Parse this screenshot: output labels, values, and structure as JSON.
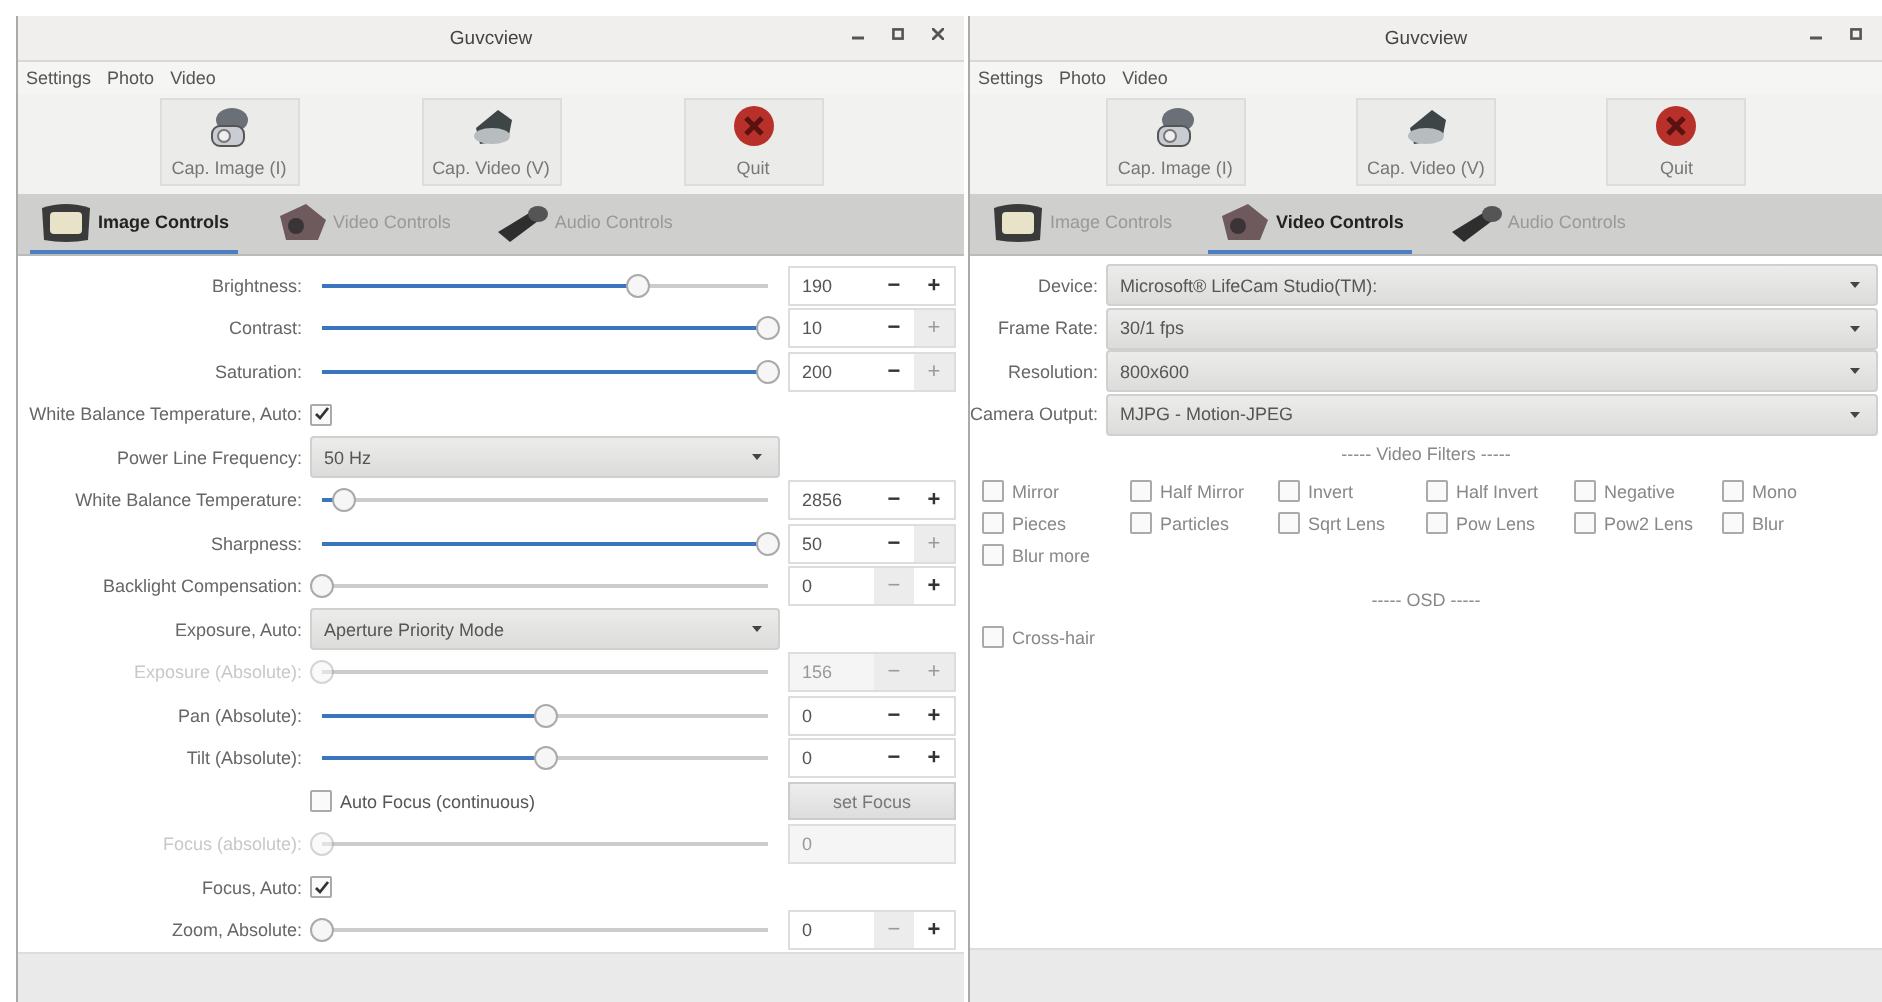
{
  "windows": [
    {
      "title": "Guvcview",
      "menu": [
        "Settings",
        "Photo",
        "Video"
      ],
      "toolbar": [
        {
          "kind": "image",
          "label": "Cap. Image (I)"
        },
        {
          "kind": "video",
          "label": "Cap. Video (V)"
        },
        {
          "kind": "quit",
          "label": "Quit"
        }
      ],
      "tabs": [
        {
          "label": "Image Controls",
          "selected": true
        },
        {
          "label": "Video Controls",
          "selected": false
        },
        {
          "label": "Audio Controls",
          "selected": false
        }
      ],
      "controls": [
        {
          "kind": "slider",
          "label": "Brightness:",
          "level": 0.71,
          "value": "190",
          "disabled": false,
          "minus": {
            "label": "−",
            "disabled": false
          },
          "plus": {
            "label": "+",
            "disabled": false
          }
        },
        {
          "kind": "slider",
          "label": "Contrast:",
          "level": 1,
          "value": "10",
          "disabled": false,
          "minus": {
            "label": "−",
            "disabled": false
          },
          "plus": {
            "label": "+",
            "disabled": true
          }
        },
        {
          "kind": "slider",
          "label": "Saturation:",
          "level": 1,
          "value": "200",
          "disabled": false,
          "minus": {
            "label": "−",
            "disabled": false
          },
          "plus": {
            "label": "+",
            "disabled": true
          }
        },
        {
          "kind": "check",
          "label": "White Balance Temperature, Auto:",
          "checked": true
        },
        {
          "kind": "combo",
          "label": "Power Line Frequency:",
          "value": "50 Hz"
        },
        {
          "kind": "slider",
          "label": "White Balance Temperature:",
          "level": 0.05,
          "value": "2856",
          "disabled": false,
          "minus": {
            "label": "−",
            "disabled": false
          },
          "plus": {
            "label": "+",
            "disabled": false
          }
        },
        {
          "kind": "slider",
          "label": "Sharpness:",
          "level": 1,
          "value": "50",
          "disabled": false,
          "minus": {
            "label": "−",
            "disabled": false
          },
          "plus": {
            "label": "+",
            "disabled": true
          }
        },
        {
          "kind": "slider",
          "label": "Backlight Compensation:",
          "level": 0,
          "value": "0",
          "disabled": false,
          "minus": {
            "label": "−",
            "disabled": true
          },
          "plus": {
            "label": "+",
            "disabled": false
          }
        },
        {
          "kind": "combo",
          "label": "Exposure, Auto:",
          "value": "Aperture Priority Mode"
        },
        {
          "kind": "slider",
          "label": "Exposure (Absolute):",
          "level": 0,
          "value": "156",
          "disabled": true,
          "minus": {
            "label": "−",
            "disabled": true
          },
          "plus": {
            "label": "+",
            "disabled": true
          }
        },
        {
          "kind": "slider",
          "label": "Pan (Absolute):",
          "level": 0.5,
          "value": "0",
          "disabled": false,
          "minus": {
            "label": "−",
            "disabled": false
          },
          "plus": {
            "label": "+",
            "disabled": false
          }
        },
        {
          "kind": "slider",
          "label": "Tilt (Absolute):",
          "level": 0.5,
          "value": "0",
          "disabled": false,
          "minus": {
            "label": "−",
            "disabled": false
          },
          "plus": {
            "label": "+",
            "disabled": false
          }
        },
        {
          "kind": "checkbutton",
          "label": "Auto Focus (continuous)",
          "checked": false,
          "button": "set Focus"
        },
        {
          "kind": "slider",
          "label": "Focus (absolute):",
          "level": 0,
          "value": "0",
          "disabled": true
        },
        {
          "kind": "check",
          "label": "Focus, Auto:",
          "checked": true
        },
        {
          "kind": "slider",
          "label": "Zoom, Absolute:",
          "level": 0,
          "value": "0",
          "disabled": false,
          "minus": {
            "label": "−",
            "disabled": true
          },
          "plus": {
            "label": "+",
            "disabled": false
          }
        }
      ]
    },
    {
      "title": "Guvcview",
      "menu": [
        "Settings",
        "Photo",
        "Video"
      ],
      "toolbar": [
        {
          "kind": "image",
          "label": "Cap. Image (I)"
        },
        {
          "kind": "video",
          "label": "Cap. Video (V)"
        },
        {
          "kind": "quit",
          "label": "Quit"
        }
      ],
      "tabs": [
        {
          "label": "Image Controls",
          "selected": false
        },
        {
          "label": "Video Controls",
          "selected": true
        },
        {
          "label": "Audio Controls",
          "selected": false
        }
      ],
      "controls": [
        {
          "kind": "combo",
          "label": "Device:",
          "value": "Microsoft® LifeCam Studio(TM):"
        },
        {
          "kind": "combo",
          "label": "Frame Rate:",
          "value": "30/1 fps"
        },
        {
          "kind": "combo",
          "label": "Resolution:",
          "value": "800x600"
        },
        {
          "kind": "combo",
          "label": "Camera Output:",
          "value": "MJPG - Motion-JPEG"
        },
        {
          "kind": "heading",
          "label": "----- Video Filters -----"
        },
        {
          "kind": "grid",
          "items": [
            {
              "label": "Mirror",
              "checked": false
            },
            {
              "label": "Half Mirror",
              "checked": false
            },
            {
              "label": "Invert",
              "checked": false
            },
            {
              "label": "Half Invert",
              "checked": false
            },
            {
              "label": "Negative",
              "checked": false
            },
            {
              "label": "Mono",
              "checked": false
            },
            {
              "label": "Pieces",
              "checked": false
            },
            {
              "label": "Particles",
              "checked": false
            },
            {
              "label": "Sqrt Lens",
              "checked": false
            },
            {
              "label": "Pow Lens",
              "checked": false
            },
            {
              "label": "Pow2 Lens",
              "checked": false
            },
            {
              "label": "Blur",
              "checked": false
            },
            {
              "label": "Blur more",
              "checked": false
            }
          ]
        },
        {
          "kind": "heading",
          "label": "----- OSD -----"
        },
        {
          "kind": "grid",
          "items": [
            {
              "label": "Cross-hair",
              "checked": false
            }
          ]
        }
      ]
    }
  ]
}
